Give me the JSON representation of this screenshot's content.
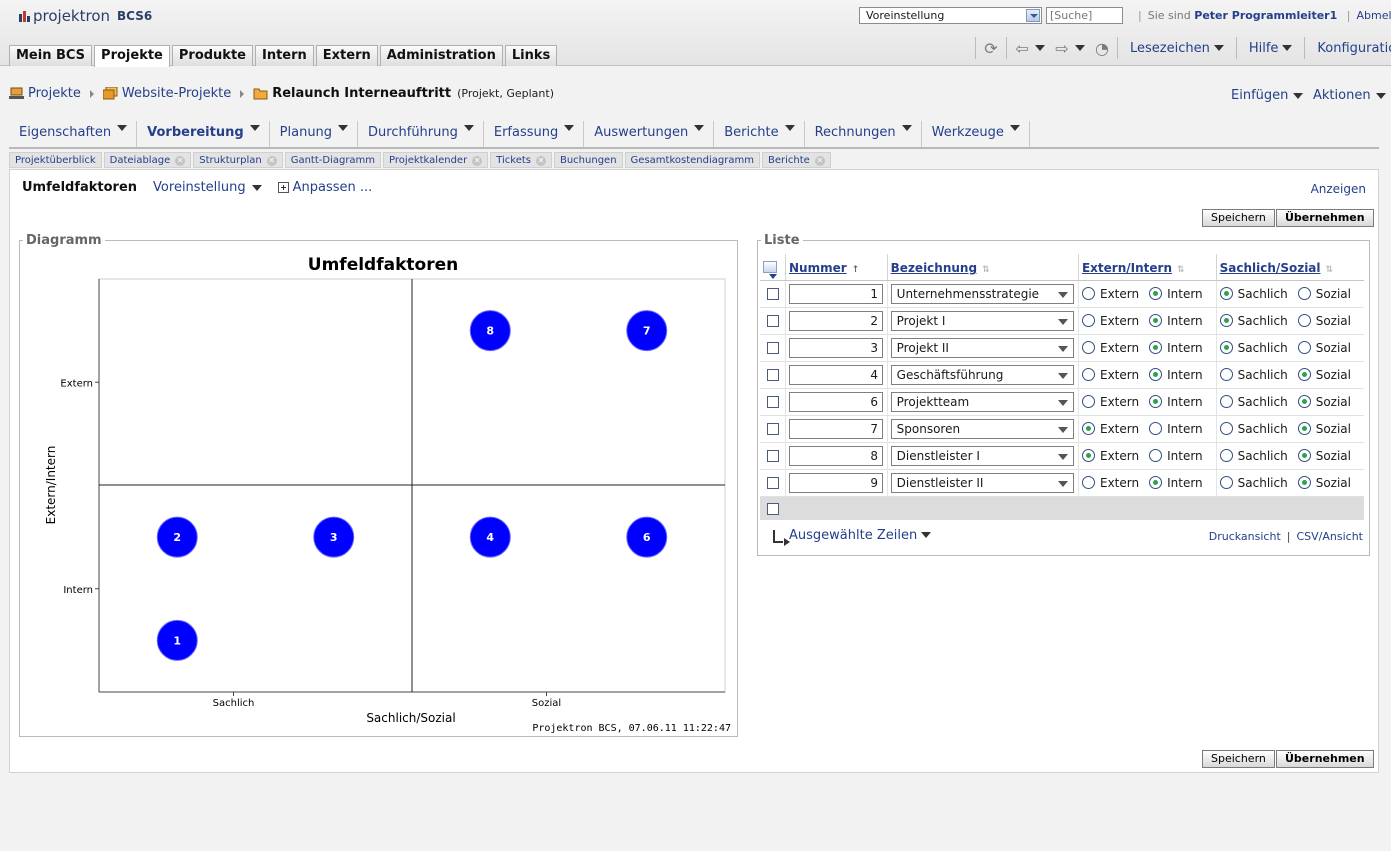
{
  "header": {
    "product": "projektron",
    "version": "BCS6",
    "preset_select": "Voreinstellung",
    "search_placeholder": "[Suche]",
    "you_are": "Sie sind",
    "user": "Peter Programmleiter1",
    "logout": "Abmelden",
    "main_tabs": [
      "Mein BCS",
      "Projekte",
      "Produkte",
      "Intern",
      "Extern",
      "Administration",
      "Links"
    ],
    "menus": [
      "Lesezeichen",
      "Hilfe",
      "Konfiguration"
    ]
  },
  "breadcrumb": {
    "items": [
      "Projekte",
      "Website-Projekte"
    ],
    "current": "Relaunch Interneauftritt",
    "current_meta": "(Projekt, Geplant)",
    "actions": [
      "Einfügen",
      "Aktionen"
    ]
  },
  "object_menu": [
    "Eigenschaften",
    "Vorbereitung",
    "Planung",
    "Durchführung",
    "Erfassung",
    "Auswertungen",
    "Berichte",
    "Rechnungen",
    "Werkzeuge"
  ],
  "subtabs": [
    {
      "label": "Projektüberblick",
      "closable": false
    },
    {
      "label": "Dateiablage",
      "closable": true
    },
    {
      "label": "Strukturplan",
      "closable": true
    },
    {
      "label": "Gantt-Diagramm",
      "closable": false
    },
    {
      "label": "Projektkalender",
      "closable": true
    },
    {
      "label": "Tickets",
      "closable": true
    },
    {
      "label": "Buchungen",
      "closable": false
    },
    {
      "label": "Gesamtkostendiagramm",
      "closable": false
    },
    {
      "label": "Berichte",
      "closable": true
    }
  ],
  "page": {
    "title": "Umfeldfaktoren",
    "preset": "Voreinstellung",
    "customize": "Anpassen ...",
    "show": "Anzeigen",
    "save": "Speichern",
    "apply": "Übernehmen"
  },
  "diagram": {
    "legend": "Diagramm",
    "footer": "Projektron BCS, 07.06.11  11:22:47"
  },
  "chart_data": {
    "type": "scatter",
    "title": "Umfeldfaktoren",
    "xlabel": "Sachlich/Sozial",
    "ylabel": "Extern/Intern",
    "x_ticks": [
      "Sachlich",
      "Sozial"
    ],
    "y_ticks": [
      "Extern",
      "Intern"
    ],
    "grid": "quadrants",
    "point_color": "#0000ff",
    "points": [
      {
        "label": "1",
        "x": 0.25,
        "y": -1.5
      },
      {
        "label": "2",
        "x": 0.25,
        "y": -0.5
      },
      {
        "label": "3",
        "x": 0.75,
        "y": -0.5
      },
      {
        "label": "4",
        "x": 1.25,
        "y": -0.5
      },
      {
        "label": "6",
        "x": 1.75,
        "y": -0.5
      },
      {
        "label": "7",
        "x": 1.75,
        "y": 1.5
      },
      {
        "label": "8",
        "x": 1.25,
        "y": 1.5
      }
    ],
    "xlim": [
      0,
      2
    ],
    "ylim": [
      -2,
      2
    ]
  },
  "list": {
    "legend": "Liste",
    "columns": [
      "Nummer",
      "Bezeichnung",
      "Extern/Intern",
      "Sachlich/Sozial"
    ],
    "opt_ei": [
      "Extern",
      "Intern"
    ],
    "opt_ss": [
      "Sachlich",
      "Sozial"
    ],
    "rows": [
      {
        "nummer": "1",
        "bez": "Unternehmensstrategie",
        "ei": "Intern",
        "ss": "Sachlich"
      },
      {
        "nummer": "2",
        "bez": "Projekt I",
        "ei": "Intern",
        "ss": "Sachlich"
      },
      {
        "nummer": "3",
        "bez": "Projekt II",
        "ei": "Intern",
        "ss": "Sachlich"
      },
      {
        "nummer": "4",
        "bez": "Geschäftsführung",
        "ei": "Intern",
        "ss": "Sozial"
      },
      {
        "nummer": "6",
        "bez": "Projektteam",
        "ei": "Intern",
        "ss": "Sozial"
      },
      {
        "nummer": "7",
        "bez": "Sponsoren",
        "ei": "Extern",
        "ss": "Sozial"
      },
      {
        "nummer": "8",
        "bez": "Dienstleister I",
        "ei": "Extern",
        "ss": "Sozial"
      },
      {
        "nummer": "9",
        "bez": "Dienstleister II",
        "ei": "Intern",
        "ss": "Sozial"
      }
    ],
    "selected_rows": "Ausgewählte Zeilen",
    "print_view": "Druckansicht",
    "csv_view": "CSV/Ansicht"
  }
}
